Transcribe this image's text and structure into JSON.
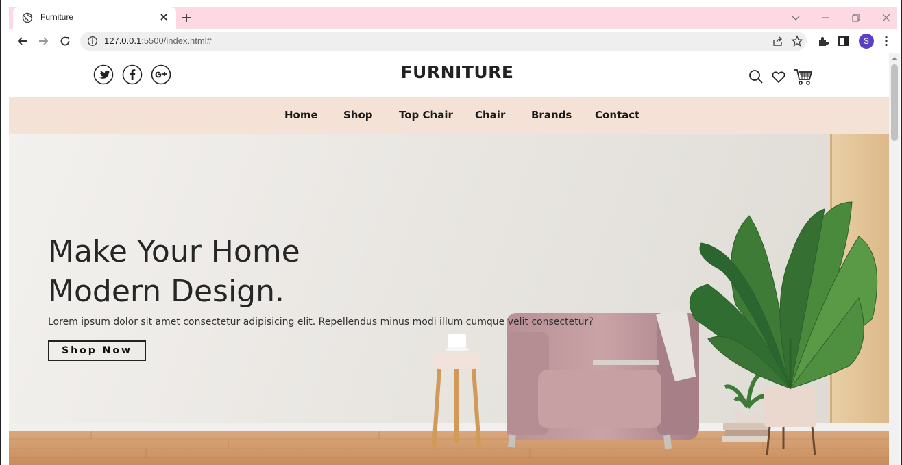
{
  "browser": {
    "tab_title": "Furniture",
    "url_host": "127.0.0.1",
    "url_rest": ":5500/index.html#",
    "profile_initial": "S",
    "tabstrip_color": "#fdd9e3"
  },
  "site": {
    "brand": "FURNITURE",
    "social_icons": [
      "twitter-icon",
      "facebook-icon",
      "google-plus-icon"
    ],
    "header_icons": [
      "search-icon",
      "heart-icon",
      "cart-icon"
    ],
    "nav": [
      "Home",
      "Shop",
      "Top Chair",
      "Chair",
      "Brands",
      "Contact"
    ],
    "nav_bg": "#f4e2d6"
  },
  "hero": {
    "title_line1": "Make Your Home",
    "title_line2": "Modern Design.",
    "text": "Lorem ipsum dolor sit amet consectetur adipisicing elit. Repellendus minus modi illum cumque velit consectetur?",
    "button": "Shop Now"
  }
}
